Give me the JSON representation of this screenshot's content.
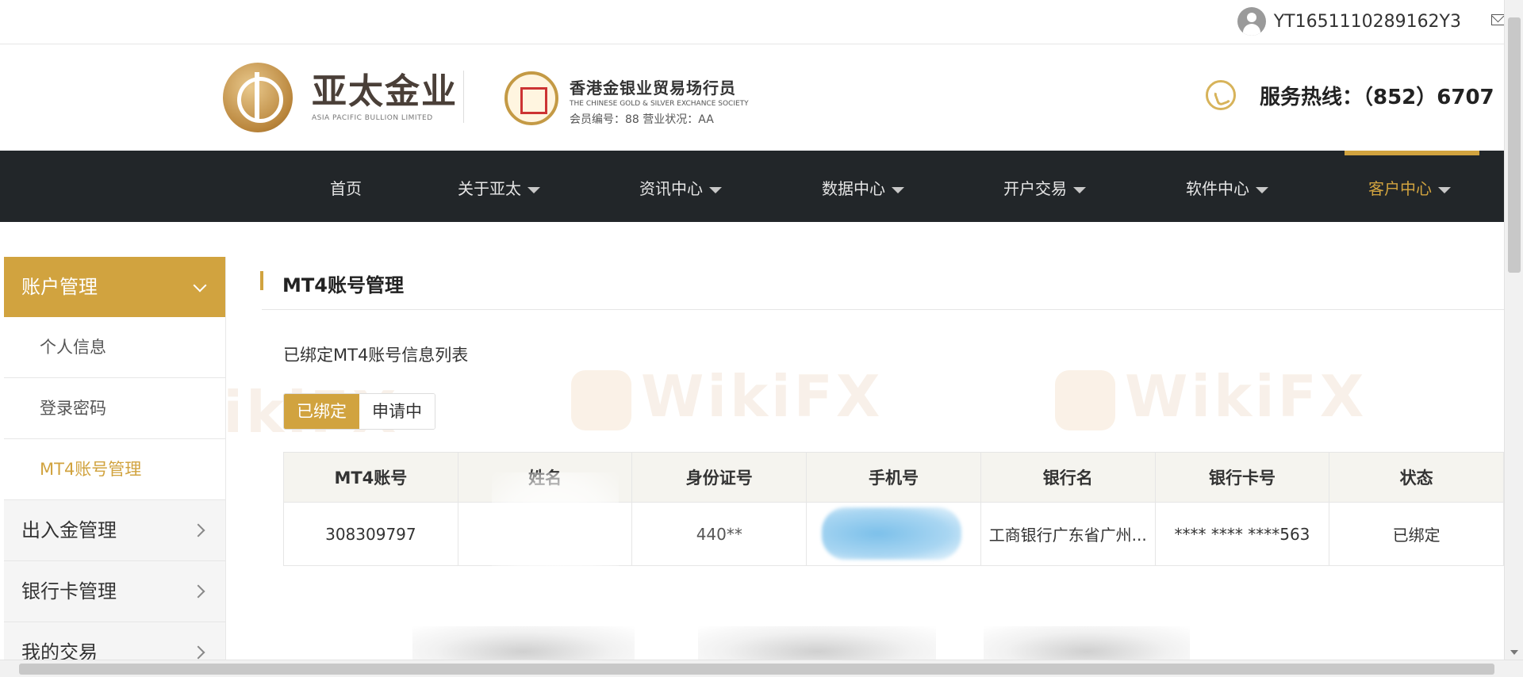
{
  "user": {
    "username": "YT1651110289162Y3"
  },
  "brand": {
    "name_cn": "亚太金业",
    "name_en": "ASIA PACIFIC BULLION LIMITED",
    "society_title": "香港金银业贸易场行员",
    "society_en": "THE CHINESE GOLD & SILVER EXCHANCE SOCIETY",
    "society_member": "会员编号：88   营业状况：AA"
  },
  "hotline": {
    "label": "服务热线：（852）6707"
  },
  "nav": {
    "items": [
      {
        "label": "首页",
        "has_caret": false
      },
      {
        "label": "关于亚太",
        "has_caret": true
      },
      {
        "label": "资讯中心",
        "has_caret": true
      },
      {
        "label": "数据中心",
        "has_caret": true
      },
      {
        "label": "开户交易",
        "has_caret": true
      },
      {
        "label": "软件中心",
        "has_caret": true
      },
      {
        "label": "客户中心",
        "has_caret": true,
        "active": true
      }
    ]
  },
  "sidebar": {
    "header": "账户管理",
    "sub_items": [
      "个人信息",
      "登录密码",
      "MT4账号管理"
    ],
    "active_sub": "MT4账号管理",
    "items": [
      "出入金管理",
      "银行卡管理",
      "我的交易"
    ]
  },
  "main": {
    "title": "MT4账号管理",
    "caption": "已绑定MT4账号信息列表",
    "tabs": [
      "已绑定",
      "申请中"
    ],
    "active_tab": "已绑定",
    "table": {
      "headers": [
        "MT4账号",
        "姓名",
        "身份证号",
        "手机号",
        "银行名",
        "银行卡号",
        "状态"
      ],
      "rows": [
        [
          "308309797",
          "",
          "440**",
          "",
          "工商银行广东省广州...",
          "**** **** ****563",
          "已绑定"
        ]
      ]
    }
  },
  "watermark": {
    "text": "WikiFX"
  },
  "colors": {
    "accent": "#d1a33f",
    "nav_bg": "#222629",
    "table_header_bg": "#f5f4ef"
  }
}
